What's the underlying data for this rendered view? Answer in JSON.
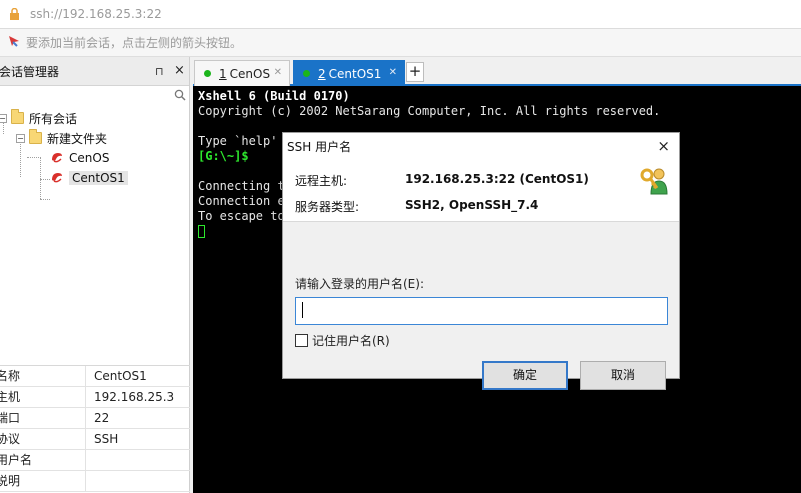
{
  "address_bar": {
    "text": "ssh://192.168.25.3:22"
  },
  "hint_bar": {
    "text": "要添加当前会话，点击左侧的箭头按钮。"
  },
  "session_panel": {
    "title": "会话管理器",
    "pin_glyph": "⊓",
    "close_glyph": "×",
    "tree": {
      "root": "所有会话",
      "folder": "新建文件夹",
      "sessions": [
        "CenOS",
        "CentOS1"
      ],
      "selected": "CentOS1"
    },
    "properties": [
      {
        "key": "名称",
        "value": "CentOS1"
      },
      {
        "key": "主机",
        "value": "192.168.25.3"
      },
      {
        "key": "端口",
        "value": "22"
      },
      {
        "key": "协议",
        "value": "SSH"
      },
      {
        "key": "用户名",
        "value": ""
      },
      {
        "key": "说明",
        "value": ""
      }
    ]
  },
  "tabs": [
    {
      "num": "1",
      "label": "CenOS",
      "active": false
    },
    {
      "num": "2",
      "label": "CentOS1",
      "active": true
    }
  ],
  "tab_add": "+",
  "terminal": {
    "line1": "Xshell 6 (Build 0170)",
    "line2": "Copyright (c) 2002 NetSarang Computer, Inc. All rights reserved.",
    "line3": "Type `help'",
    "prompt": "[G:\\~]$",
    "line4": "Connecting t",
    "line5": "Connection e",
    "line6": "To escape to"
  },
  "dialog": {
    "title": "SSH 用户名",
    "close_glyph": "×",
    "remote_host_label": "远程主机:",
    "remote_host_value": "192.168.25.3:22 (CentOS1)",
    "server_type_label": "服务器类型:",
    "server_type_value": "SSH2, OpenSSH_7.4",
    "username_label": "请输入登录的用户名(E):",
    "username_value": "",
    "remember_label": "记住用户名(R)",
    "remember_checked": false,
    "ok_label": "确定",
    "cancel_label": "取消"
  },
  "colors": {
    "accent": "#1a73c8",
    "terminal_bg": "#000000",
    "prompt_green": "#2de82d",
    "status_dot": "#1bb51b"
  }
}
